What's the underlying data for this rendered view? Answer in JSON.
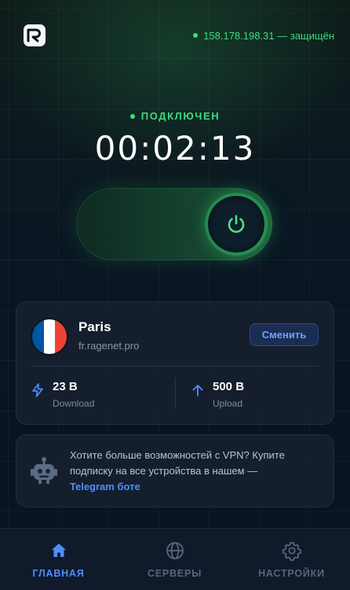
{
  "header": {
    "logo": "logo-icon",
    "ip_status": "158.178.198.31 — защищён"
  },
  "connection": {
    "state": "ПОДКЛЮЧЕН",
    "timer": "00:02:13",
    "toggle_on": true
  },
  "server": {
    "city": "Paris",
    "host": "fr.ragenet.pro",
    "flag": [
      "#0055a4",
      "#ffffff",
      "#ef4135"
    ],
    "change_label": "Сменить",
    "download": {
      "value": "23 B",
      "label": "Download"
    },
    "upload": {
      "value": "500 B",
      "label": "Upload"
    }
  },
  "promo": {
    "text": "Хотите больше возможностей с VPN? Купите подписку на все устройства в нашем —",
    "link": "Telegram боте"
  },
  "nav": {
    "home": "ГЛАВНАЯ",
    "servers": "СЕРВЕРЫ",
    "settings": "НАСТРОЙКИ",
    "active": "home"
  },
  "colors": {
    "accent_green": "#3ddc7a",
    "accent_blue": "#4f8dff",
    "background": "#0b1320"
  }
}
